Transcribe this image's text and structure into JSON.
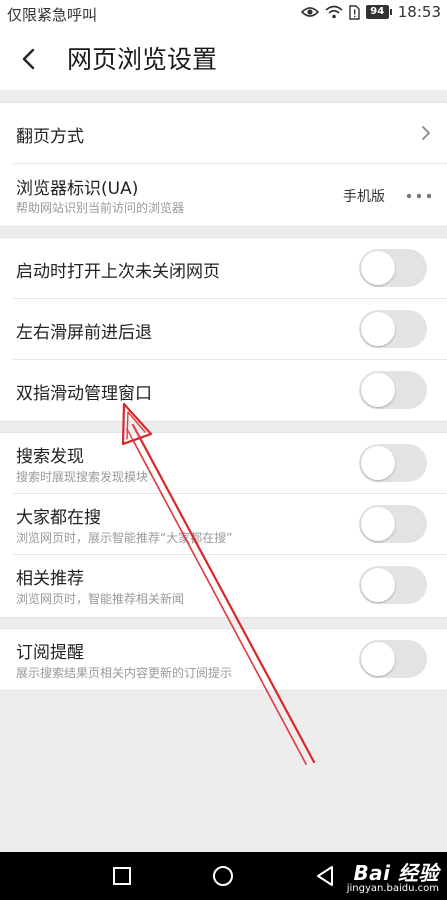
{
  "status_bar": {
    "carrier": "仅限紧急呼叫",
    "battery": "94",
    "time": "18:53"
  },
  "header": {
    "title": "网页浏览设置"
  },
  "section1": {
    "page_turn": {
      "label": "翻页方式"
    },
    "ua": {
      "label": "浏览器标识(UA)",
      "desc": "帮助网站识别当前访问的浏览器",
      "value": "手机版"
    }
  },
  "section2": {
    "items": [
      {
        "label": "启动时打开上次未关闭网页",
        "enabled": false
      },
      {
        "label": "左右滑屏前进后退",
        "enabled": false
      },
      {
        "label": "双指滑动管理窗口",
        "enabled": false
      }
    ]
  },
  "section3": {
    "items": [
      {
        "label": "搜索发现",
        "desc": "搜索时展现搜索发现模块",
        "enabled": false
      },
      {
        "label": "大家都在搜",
        "desc": "浏览网页时，展示智能推荐“大家都在搜”",
        "enabled": false
      },
      {
        "label": "相关推荐",
        "desc": "浏览网页时，智能推荐相关新闻",
        "enabled": false
      }
    ]
  },
  "section4": {
    "items": [
      {
        "label": "订阅提醒",
        "desc": "展示搜索结果页相关内容更新的订阅提示",
        "enabled": false
      }
    ]
  },
  "colors": {
    "annotation_arrow": "#d9262a",
    "toggle_off": "#e3e3e3"
  },
  "watermark": {
    "logo": "Bai 经验",
    "url": "jingyan.baidu.com"
  }
}
